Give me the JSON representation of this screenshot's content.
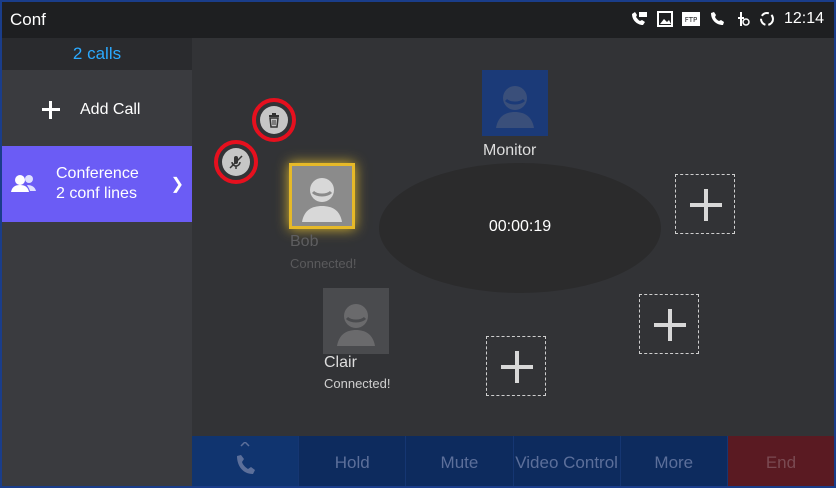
{
  "status_bar": {
    "app_title": "Conf",
    "time": "12:14",
    "icons": [
      "voicemail-icon",
      "image-icon",
      "ftp-icon",
      "phone-icon",
      "signal-icon",
      "sync-icon"
    ],
    "ftp_label": "FTP"
  },
  "sidebar": {
    "calls_count": "2 calls",
    "add_call_label": "Add Call",
    "conference": {
      "title": "Conference",
      "subtitle": "2 conf lines"
    }
  },
  "conference_view": {
    "timer": "00:00:19",
    "participants": [
      {
        "name": "Monitor",
        "status": ""
      },
      {
        "name": "Bob",
        "status": "Connected!"
      },
      {
        "name": "Clair",
        "status": "Connected!"
      }
    ]
  },
  "bottom_bar": {
    "hold": "Hold",
    "mute": "Mute",
    "video_control": "Video Control",
    "more": "More",
    "end": "End"
  },
  "colors": {
    "accent_purple": "#6b5cf5",
    "calls_blue": "#2aa9ff",
    "highlight_red": "#e6101e",
    "end_red": "#5a1a22"
  }
}
